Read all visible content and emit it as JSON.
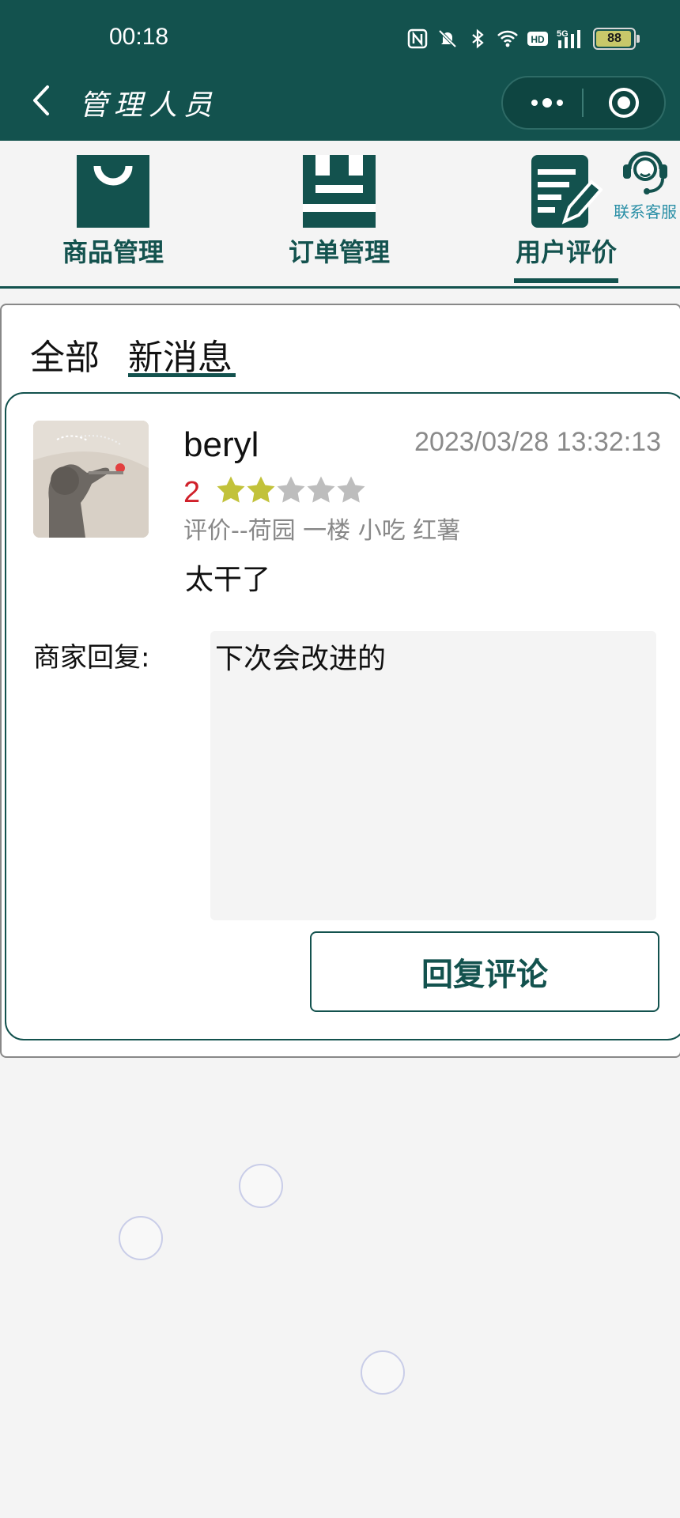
{
  "status_bar": {
    "time": "00:18",
    "battery": "88",
    "icons": [
      "nfc-icon",
      "mute-icon",
      "bluetooth-icon",
      "wifi-icon",
      "hd-icon",
      "signal-5g-icon"
    ]
  },
  "title_bar": {
    "title": "管理人员",
    "back_icon": "back-chevron-icon",
    "more_icon": "more-dots-icon",
    "close_icon": "target-circle-icon"
  },
  "categories": [
    {
      "label": "商品管理",
      "icon": "shopping-bag-icon",
      "active": false
    },
    {
      "label": "订单管理",
      "icon": "order-list-icon",
      "active": false
    },
    {
      "label": "用户评价",
      "icon": "review-edit-icon",
      "active": true
    }
  ],
  "customer_service": {
    "label": "联系客服",
    "icon": "headset-icon"
  },
  "filter_tabs": [
    {
      "label": "全部",
      "active": false
    },
    {
      "label": "新消息",
      "active": true
    }
  ],
  "review": {
    "username": "beryl",
    "timestamp": "2023/03/28 13:32:13",
    "rating": "2",
    "stars_filled": 2,
    "stars_total": 5,
    "target": "评价--荷园 一楼 小吃 红薯",
    "content": "太干了",
    "reply_label": "商家回复:",
    "reply_text": "下次会改进的",
    "reply_button": "回复评论"
  },
  "colors": {
    "brand": "#13524e",
    "star_filled": "#c2c23a",
    "star_empty": "#bdbdbd",
    "rating_red": "#d0202a",
    "service_blue": "#2a8fa6"
  }
}
